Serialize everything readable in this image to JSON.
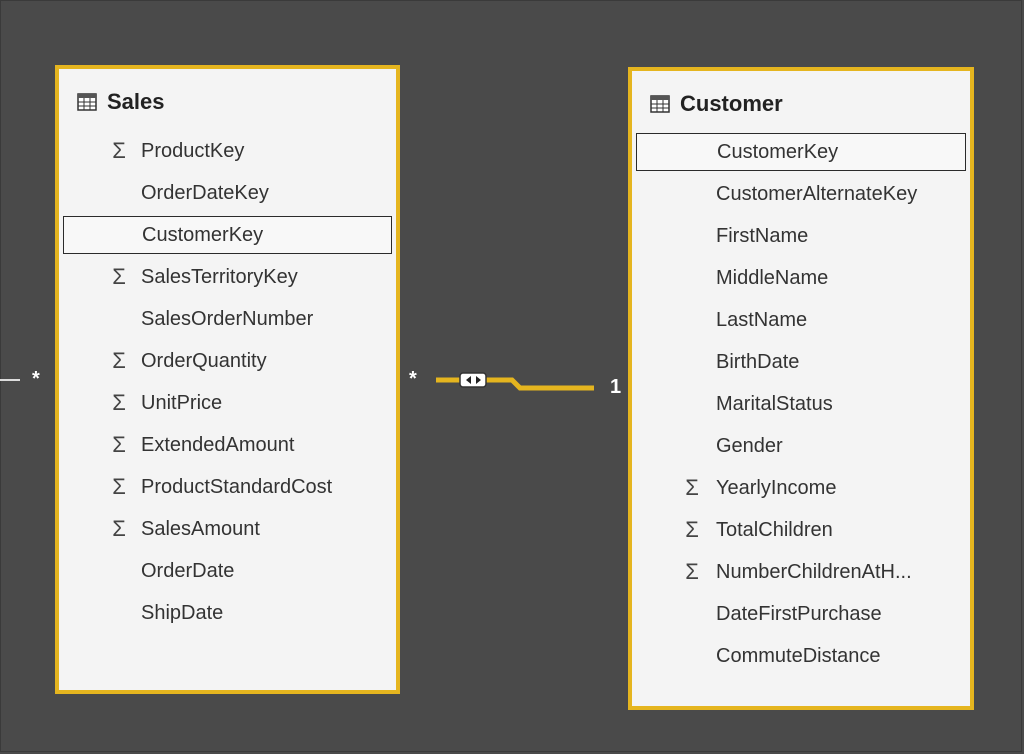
{
  "sales": {
    "title": "Sales",
    "fields": [
      {
        "name": "ProductKey",
        "sigma": true
      },
      {
        "name": "OrderDateKey",
        "sigma": false
      },
      {
        "name": "CustomerKey",
        "sigma": false,
        "selected": true
      },
      {
        "name": "SalesTerritoryKey",
        "sigma": true
      },
      {
        "name": "SalesOrderNumber",
        "sigma": false
      },
      {
        "name": "OrderQuantity",
        "sigma": true
      },
      {
        "name": "UnitPrice",
        "sigma": true
      },
      {
        "name": "ExtendedAmount",
        "sigma": true
      },
      {
        "name": "ProductStandardCost",
        "sigma": true
      },
      {
        "name": "SalesAmount",
        "sigma": true
      },
      {
        "name": "OrderDate",
        "sigma": false
      },
      {
        "name": "ShipDate",
        "sigma": false
      }
    ]
  },
  "customer": {
    "title": "Customer",
    "fields": [
      {
        "name": "CustomerKey",
        "sigma": false,
        "selected": true
      },
      {
        "name": "CustomerAlternateKey",
        "sigma": false
      },
      {
        "name": "FirstName",
        "sigma": false
      },
      {
        "name": "MiddleName",
        "sigma": false
      },
      {
        "name": "LastName",
        "sigma": false
      },
      {
        "name": "BirthDate",
        "sigma": false
      },
      {
        "name": "MaritalStatus",
        "sigma": false
      },
      {
        "name": "Gender",
        "sigma": false
      },
      {
        "name": "YearlyIncome",
        "sigma": true
      },
      {
        "name": "TotalChildren",
        "sigma": true
      },
      {
        "name": "NumberChildrenAtH...",
        "sigma": true
      },
      {
        "name": "DateFirstPurchase",
        "sigma": false
      },
      {
        "name": "CommuteDistance",
        "sigma": false
      }
    ]
  },
  "relationship": {
    "left_cardinality": "*",
    "many_side": "*",
    "one_side": "1"
  },
  "colors": {
    "canvas": "#4a4a4a",
    "card_border": "#e5b51f",
    "card_bg": "#f4f4f4",
    "relationship_line": "#e5b51f"
  },
  "sigma_symbol": "Σ",
  "icons": [
    "table-icon",
    "sigma-icon",
    "bidirectional-filter-icon"
  ]
}
